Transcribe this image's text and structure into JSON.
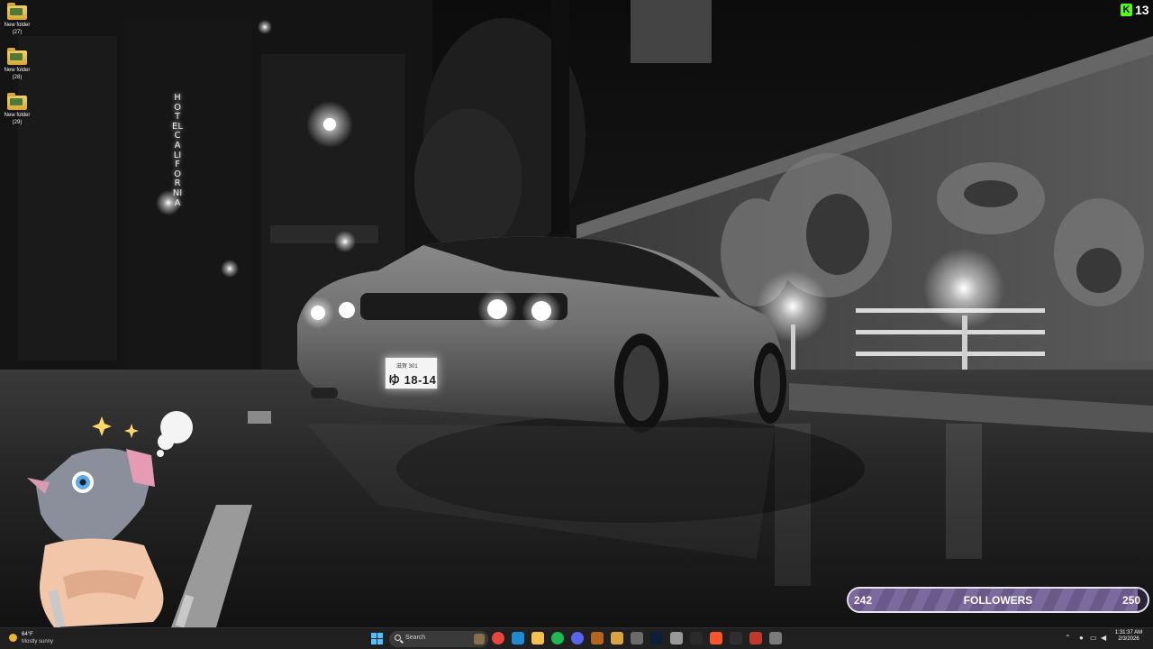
{
  "desktop": {
    "icons": [
      {
        "label": "New folder",
        "sub": "(27)"
      },
      {
        "label": "New folder",
        "sub": "(28)"
      },
      {
        "label": "New folder",
        "sub": "(29)"
      }
    ]
  },
  "wallpaper": {
    "hotel_sign": "HOTEL CALIFORNIA",
    "plate_prefecture": "滋賀 301",
    "plate_number": "ゆ 18-14"
  },
  "overlay": {
    "badge_count": "13",
    "badge_color": "#53fc18",
    "followers": {
      "current": "242",
      "title": "FOLLOWERS",
      "target": "250",
      "progress": 0.968,
      "fill_color": "#7b6a9e"
    }
  },
  "taskbar": {
    "weather_temp": "64°F",
    "weather_cond": "Mostly sunny",
    "search_placeholder": "Search",
    "pinned_apps": [
      {
        "name": "chrome-icon",
        "color": "#e8453c"
      },
      {
        "name": "edge-icon",
        "color": "#1f8ad2"
      },
      {
        "name": "file-explorer-icon",
        "color": "#f2c14e"
      },
      {
        "name": "spotify-icon",
        "color": "#1db954"
      },
      {
        "name": "discord-icon",
        "color": "#5865f2"
      },
      {
        "name": "app-icon",
        "color": "#b5651d"
      },
      {
        "name": "folder-icon",
        "color": "#d9a441"
      },
      {
        "name": "settings-icon",
        "color": "#6b6b6b"
      },
      {
        "name": "photoshop-icon",
        "color": "#0b1e3a"
      },
      {
        "name": "app-icon-2",
        "color": "#9a9a9a"
      },
      {
        "name": "terminal-icon",
        "color": "#2b2b2b"
      },
      {
        "name": "brave-icon",
        "color": "#fb542b"
      },
      {
        "name": "obs-icon",
        "color": "#302e31"
      },
      {
        "name": "app-icon-3",
        "color": "#c0392b"
      },
      {
        "name": "monitor-icon",
        "color": "#7a7a7a"
      }
    ],
    "clock_time": "1:31:37 AM",
    "clock_date": "2/3/2026"
  }
}
